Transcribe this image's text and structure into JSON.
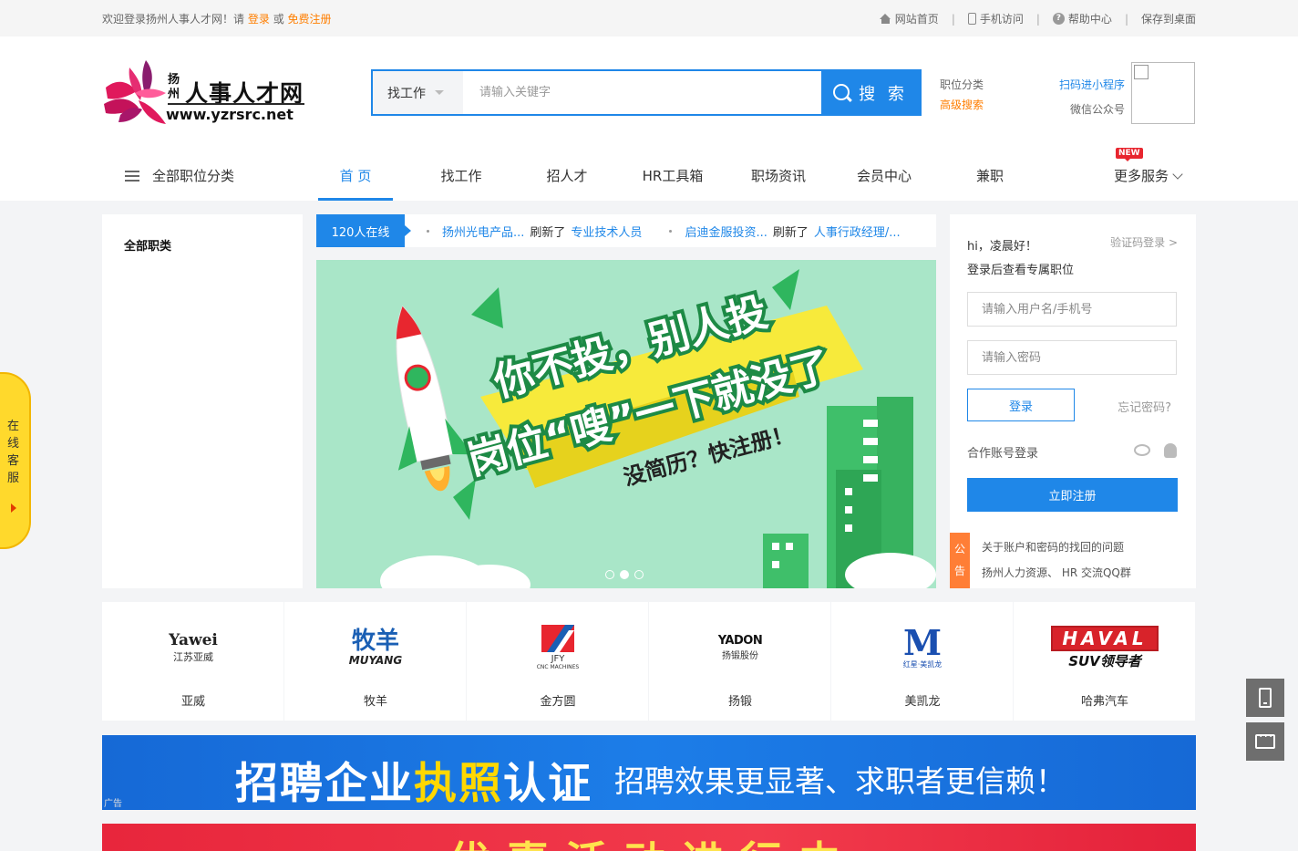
{
  "topbar": {
    "welcome_prefix": "欢迎登录扬州人事人才网！请",
    "login": "登录",
    "or": "或",
    "register": "免费注册",
    "links": [
      "网站首页",
      "手机访问",
      "帮助中心",
      "保存到桌面"
    ],
    "separator": "|"
  },
  "logo": {
    "city": "扬州",
    "name": "人事人才网",
    "url": "www.yzrsrc.net"
  },
  "search": {
    "type": "找工作",
    "placeholder": "请输入关键字",
    "button": "搜 索"
  },
  "side_links": {
    "category": "职位分类",
    "advanced": "高级搜索"
  },
  "qr": {
    "mini_program": "扫码进小程序",
    "wechat": "微信公众号"
  },
  "nav": {
    "all_categories": "全部职位分类",
    "items": [
      "首 页",
      "找工作",
      "招人才",
      "HR工具箱",
      "职场资讯",
      "会员中心",
      "兼职"
    ],
    "more": "更多服务",
    "badge": "NEW"
  },
  "category_panel": {
    "title": "全部职类"
  },
  "ticker": {
    "online": "120人在线",
    "messages": [
      {
        "company": "扬州光电产品...",
        "action": "刷新了",
        "job": "专业技术人员"
      },
      {
        "company": "启迪金服投资...",
        "action": "刷新了",
        "job": "人事行政经理/..."
      }
    ]
  },
  "banner": {
    "line1": "你不投，别人投",
    "line2": "岗位“嗖”一下就没了",
    "line3": "没简历？快注册！",
    "slide_count": 3,
    "active_slide": 2
  },
  "login": {
    "greeting": "hi，凌晨好！",
    "sms_login": "验证码登录 >",
    "subtitle": "登录后查看专属职位",
    "username_placeholder": "请输入用户名/手机号",
    "password_placeholder": "请输入密码",
    "login_button": "登录",
    "forgot": "忘记密码?",
    "partner_login": "合作账号登录",
    "register_button": "立即注册",
    "notice_tag": "公告",
    "notices": [
      "关于账户和密码的找回的问题",
      "扬州人力资源、 HR 交流QQ群"
    ]
  },
  "companies": [
    {
      "name": "亚威",
      "logo_text": "Yawei",
      "logo_sub": "江苏亚威"
    },
    {
      "name": "牧羊",
      "logo_text": "牧羊",
      "logo_sub": "MUYANG"
    },
    {
      "name": "金方圆",
      "logo_text": "JFY",
      "logo_sub": "CNC MACHINES"
    },
    {
      "name": "扬锻",
      "logo_text": "YADON",
      "logo_sub": "扬锻股份"
    },
    {
      "name": "美凯龙",
      "logo_text": "M",
      "logo_sub": "红星·美凯龙"
    },
    {
      "name": "哈弗汽车",
      "logo_text": "HAVAL",
      "logo_sub": "SUV领导者"
    }
  ],
  "ad1": {
    "part1": "招聘企业",
    "highlight": "执照",
    "part2": "认证",
    "sub": "招聘效果更显著、求职者更信赖！",
    "tag": "广告"
  },
  "ad2": {
    "text": "优惠活动进行中"
  },
  "float_service": {
    "text": "在线客服"
  },
  "colors": {
    "primary": "#1f87e8",
    "accent": "#ff7e00",
    "notice": "#ff7e36"
  }
}
